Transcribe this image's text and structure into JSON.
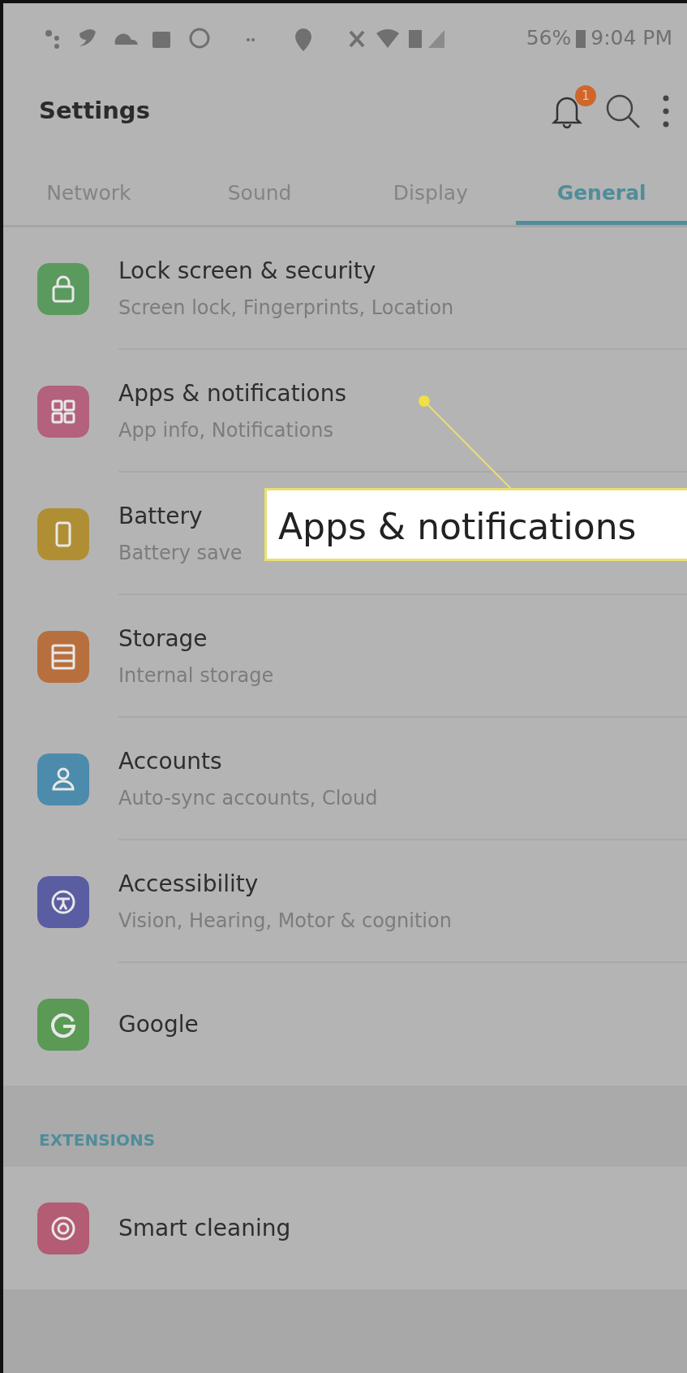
{
  "status_bar": {
    "battery": "56%",
    "time": "9:04 PM"
  },
  "toolbar": {
    "title": "Settings",
    "notification_count": "1"
  },
  "tabs": [
    {
      "label": "Network",
      "selected": false
    },
    {
      "label": "Sound",
      "selected": false
    },
    {
      "label": "Display",
      "selected": false
    },
    {
      "label": "General",
      "selected": true
    }
  ],
  "items": [
    {
      "title": "Lock screen & security",
      "subtitle": "Screen lock, Fingerprints, Location",
      "color": "#5b9a5e"
    },
    {
      "title": "Apps & notifications",
      "subtitle": "App info, Notifications",
      "color": "#b3617c"
    },
    {
      "title": "Battery",
      "subtitle": "Battery save",
      "color": "#b08f34"
    },
    {
      "title": "Storage",
      "subtitle": "Internal storage",
      "color": "#b86f3e"
    },
    {
      "title": "Accounts",
      "subtitle": "Auto-sync accounts, Cloud",
      "color": "#4c8bab"
    },
    {
      "title": "Accessibility",
      "subtitle": "Vision, Hearing, Motor & cognition",
      "color": "#5b5da3"
    },
    {
      "title": "Google",
      "color": "#5a9a55"
    }
  ],
  "section": {
    "header": "EXTENSIONS",
    "items": [
      {
        "title": "Smart cleaning",
        "color": "#b35c74"
      }
    ]
  },
  "callout": {
    "text": "Apps & notifications"
  }
}
